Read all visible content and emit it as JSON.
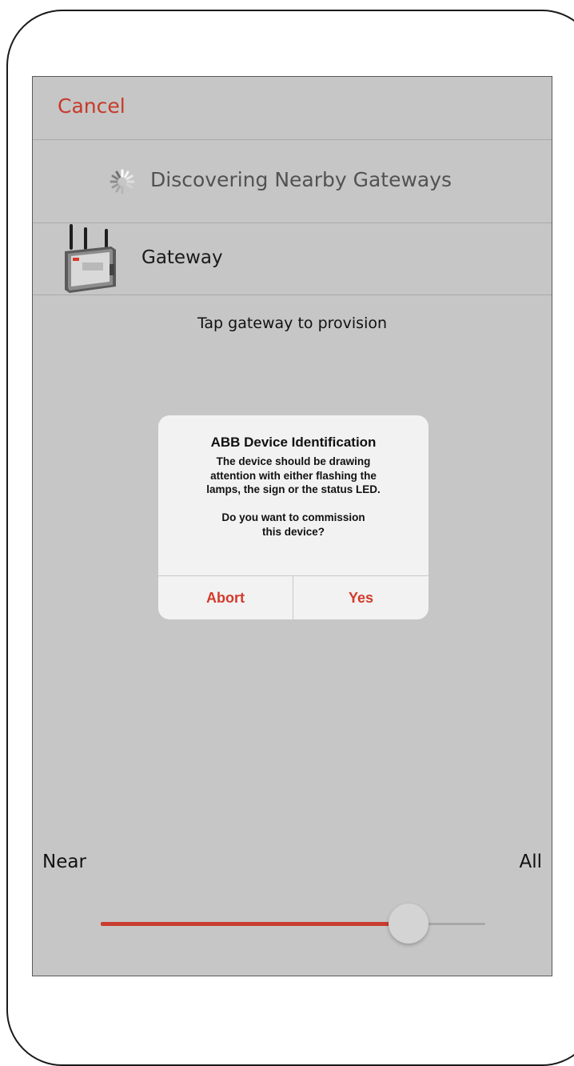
{
  "nav": {
    "cancel_label": "Cancel"
  },
  "discovery": {
    "status_label": "Discovering Nearby Gateways",
    "icon": "spinner-icon"
  },
  "gateway_list": {
    "items": [
      {
        "label": "Gateway",
        "icon": "gateway-device-image"
      }
    ]
  },
  "hint": {
    "text": "Tap gateway to provision"
  },
  "alert": {
    "title": "ABB Device Identification",
    "message": "The device should be drawing\nattention with either flashing the\nlamps, the sign or the status LED.\n\nDo you want to commission\nthis device?",
    "abort_label": "Abort",
    "yes_label": "Yes"
  },
  "range_slider": {
    "min_label": "Near",
    "max_label": "All",
    "value_fraction": 0.8
  },
  "colors": {
    "accent": "#c73a2b",
    "screen_background": "#c6c6c6",
    "alert_background": "#f2f2f2"
  }
}
